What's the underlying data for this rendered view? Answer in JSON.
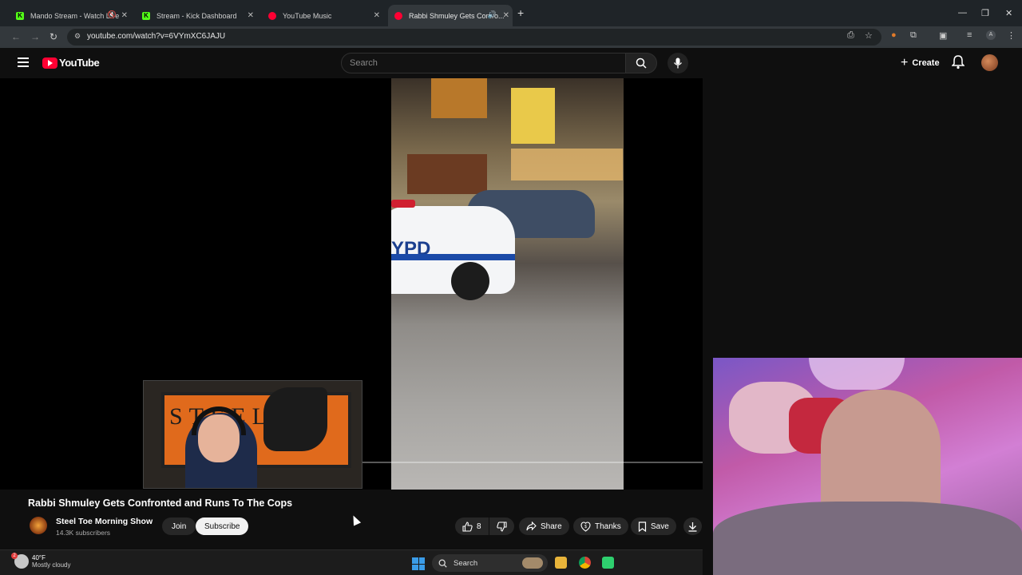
{
  "browser": {
    "tabs": [
      {
        "label": "Mando Stream - Watch Live",
        "favicon": "kick-icon",
        "muted": true
      },
      {
        "label": "Stream - Kick Dashboard",
        "favicon": "kick-icon"
      },
      {
        "label": "YouTube Music",
        "favicon": "youtube-music-icon"
      },
      {
        "label": "Rabbi Shmuley Gets Confro...",
        "favicon": "youtube-icon",
        "active": true,
        "audio": true
      }
    ],
    "url": "youtube.com/watch?v=6VYmXC6JAJU",
    "profile_initial": "A"
  },
  "youtube": {
    "logo_text": "YouTube",
    "search_placeholder": "Search",
    "create_label": "Create"
  },
  "video": {
    "title": "Rabbi Shmuley Gets Confronted and Runs To The Cops",
    "channel": "Steel Toe Morning Show",
    "subscribers": "14.3K subscribers",
    "join_label": "Join",
    "subscribe_label": "Subscribe",
    "likes": "8",
    "share_label": "Share",
    "thanks_label": "Thanks",
    "save_label": "Save",
    "frame_text": "YPD",
    "board_text": "STEEL"
  },
  "taskbar": {
    "temperature": "40°F",
    "weather": "Mostly cloudy",
    "weather_badge": "2",
    "search_label": "Search"
  },
  "colors": {
    "brand_red": "#ff0033",
    "kick_green": "#53fc18",
    "background": "#0f0f0f"
  }
}
